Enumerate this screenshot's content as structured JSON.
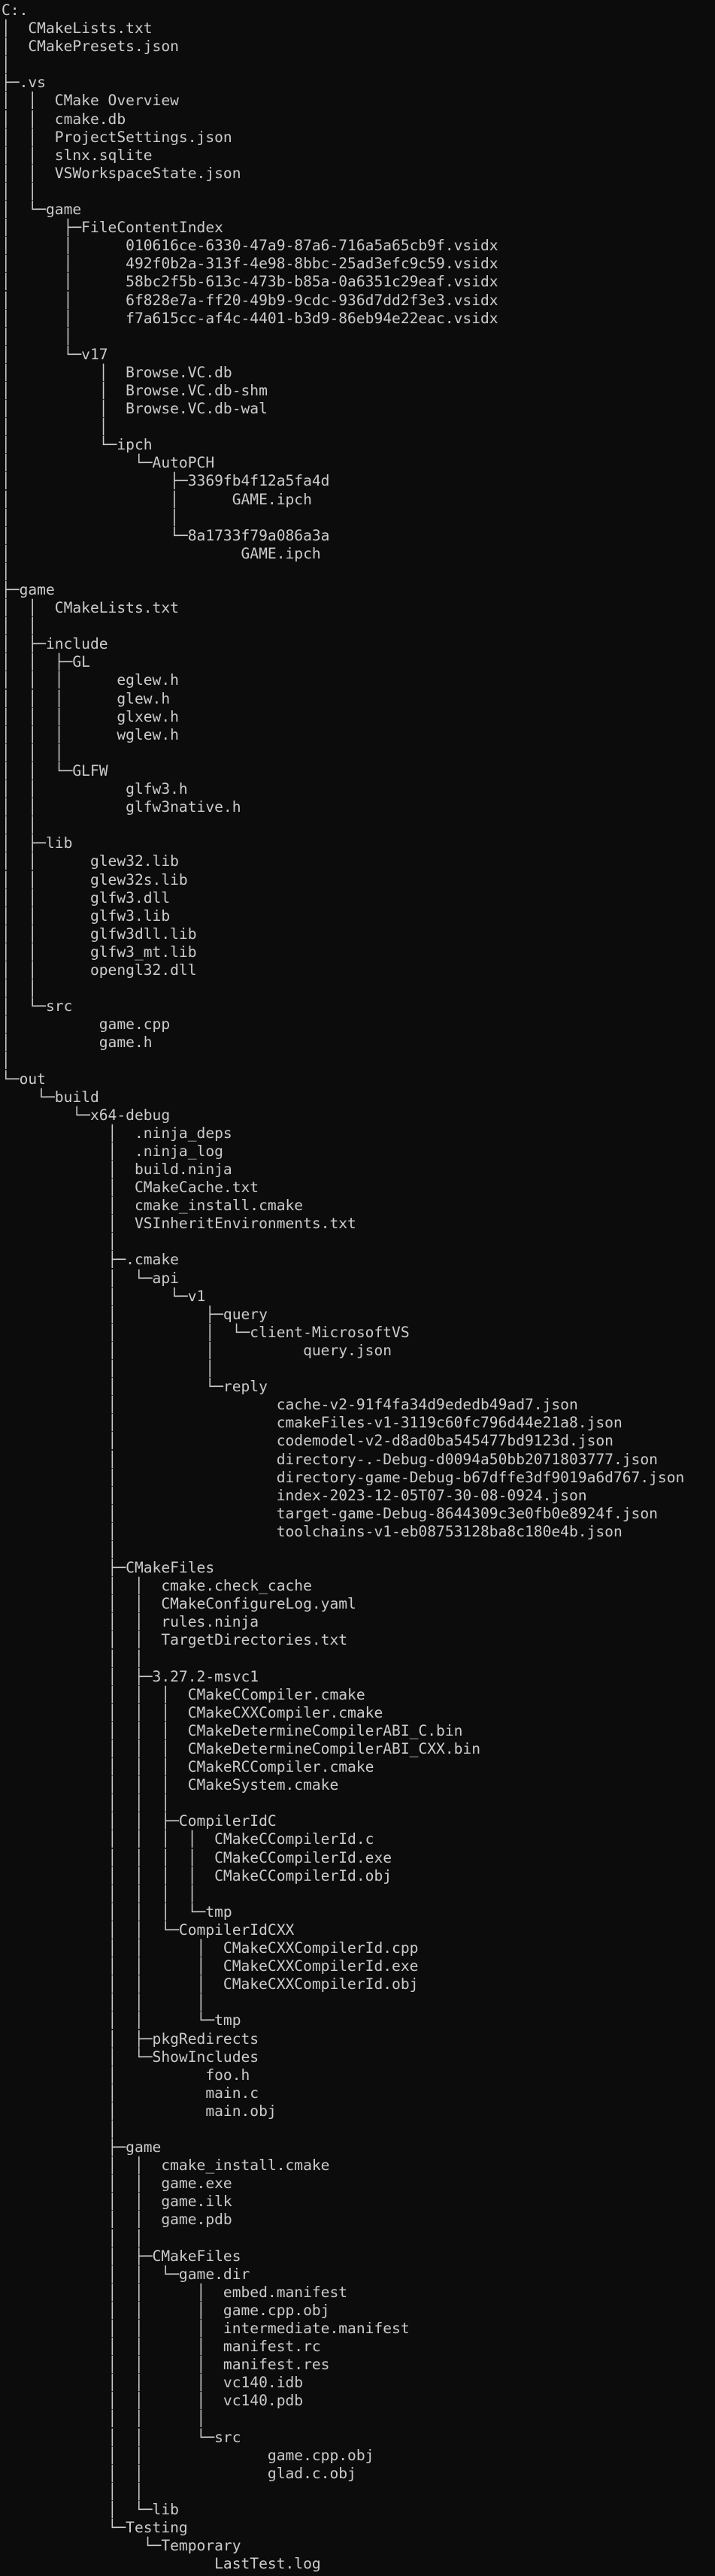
{
  "terminal": {
    "text_color": "#cccccc",
    "background": "#0c0c0c",
    "lines": [
      "C:.",
      "│  CMakeLists.txt",
      "│  CMakePresets.json",
      "│",
      "├─.vs",
      "│  │  CMake Overview",
      "│  │  cmake.db",
      "│  │  ProjectSettings.json",
      "│  │  slnx.sqlite",
      "│  │  VSWorkspaceState.json",
      "│  │",
      "│  └─game",
      "│      ├─FileContentIndex",
      "│      │      010616ce-6330-47a9-87a6-716a5a65cb9f.vsidx",
      "│      │      492f0b2a-313f-4e98-8bbc-25ad3efc9c59.vsidx",
      "│      │      58bc2f5b-613c-473b-b85a-0a6351c29eaf.vsidx",
      "│      │      6f828e7a-ff20-49b9-9cdc-936d7dd2f3e3.vsidx",
      "│      │      f7a615cc-af4c-4401-b3d9-86eb94e22eac.vsidx",
      "│      │",
      "│      └─v17",
      "│          │  Browse.VC.db",
      "│          │  Browse.VC.db-shm",
      "│          │  Browse.VC.db-wal",
      "│          │",
      "│          └─ipch",
      "│              └─AutoPCH",
      "│                  ├─3369fb4f12a5fa4d",
      "│                  │      GAME.ipch",
      "│                  │",
      "│                  └─8a1733f79a086a3a",
      "│                          GAME.ipch",
      "│",
      "├─game",
      "│  │  CMakeLists.txt",
      "│  │",
      "│  ├─include",
      "│  │  ├─GL",
      "│  │  │      eglew.h",
      "│  │  │      glew.h",
      "│  │  │      glxew.h",
      "│  │  │      wglew.h",
      "│  │  │",
      "│  │  └─GLFW",
      "│  │          glfw3.h",
      "│  │          glfw3native.h",
      "│  │",
      "│  ├─lib",
      "│  │      glew32.lib",
      "│  │      glew32s.lib",
      "│  │      glfw3.dll",
      "│  │      glfw3.lib",
      "│  │      glfw3dll.lib",
      "│  │      glfw3_mt.lib",
      "│  │      opengl32.dll",
      "│  │",
      "│  └─src",
      "│          game.cpp",
      "│          game.h",
      "│",
      "└─out",
      "    └─build",
      "        └─x64-debug",
      "            │  .ninja_deps",
      "            │  .ninja_log",
      "            │  build.ninja",
      "            │  CMakeCache.txt",
      "            │  cmake_install.cmake",
      "            │  VSInheritEnvironments.txt",
      "            │",
      "            ├─.cmake",
      "            │  └─api",
      "            │      └─v1",
      "            │          ├─query",
      "            │          │  └─client-MicrosoftVS",
      "            │          │          query.json",
      "            │          │",
      "            │          └─reply",
      "            │                  cache-v2-91f4fa34d9ededb49ad7.json",
      "            │                  cmakeFiles-v1-3119c60fc796d44e21a8.json",
      "            │                  codemodel-v2-d8ad0ba545477bd9123d.json",
      "            │                  directory-.-Debug-d0094a50bb2071803777.json",
      "            │                  directory-game-Debug-b67dffe3df9019a6d767.json",
      "            │                  index-2023-12-05T07-30-08-0924.json",
      "            │                  target-game-Debug-8644309c3e0fb0e8924f.json",
      "            │                  toolchains-v1-eb08753128ba8c180e4b.json",
      "            │",
      "            ├─CMakeFiles",
      "            │  │  cmake.check_cache",
      "            │  │  CMakeConfigureLog.yaml",
      "            │  │  rules.ninja",
      "            │  │  TargetDirectories.txt",
      "            │  │",
      "            │  ├─3.27.2-msvc1",
      "            │  │  │  CMakeCCompiler.cmake",
      "            │  │  │  CMakeCXXCompiler.cmake",
      "            │  │  │  CMakeDetermineCompilerABI_C.bin",
      "            │  │  │  CMakeDetermineCompilerABI_CXX.bin",
      "            │  │  │  CMakeRCCompiler.cmake",
      "            │  │  │  CMakeSystem.cmake",
      "            │  │  │",
      "            │  │  ├─CompilerIdC",
      "            │  │  │  │  CMakeCCompilerId.c",
      "            │  │  │  │  CMakeCCompilerId.exe",
      "            │  │  │  │  CMakeCCompilerId.obj",
      "            │  │  │  │",
      "            │  │  │  └─tmp",
      "            │  │  └─CompilerIdCXX",
      "            │  │      │  CMakeCXXCompilerId.cpp",
      "            │  │      │  CMakeCXXCompilerId.exe",
      "            │  │      │  CMakeCXXCompilerId.obj",
      "            │  │      │",
      "            │  │      └─tmp",
      "            │  ├─pkgRedirects",
      "            │  └─ShowIncludes",
      "            │          foo.h",
      "            │          main.c",
      "            │          main.obj",
      "            │",
      "            ├─game",
      "            │  │  cmake_install.cmake",
      "            │  │  game.exe",
      "            │  │  game.ilk",
      "            │  │  game.pdb",
      "            │  │",
      "            │  ├─CMakeFiles",
      "            │  │  └─game.dir",
      "            │  │      │  embed.manifest",
      "            │  │      │  game.cpp.obj",
      "            │  │      │  intermediate.manifest",
      "            │  │      │  manifest.rc",
      "            │  │      │  manifest.res",
      "            │  │      │  vc140.idb",
      "            │  │      │  vc140.pdb",
      "            │  │      │",
      "            │  │      └─src",
      "            │  │              game.cpp.obj",
      "            │  │              glad.c.obj",
      "            │  │",
      "            │  └─lib",
      "            └─Testing",
      "                └─Temporary",
      "                        LastTest.log"
    ]
  }
}
